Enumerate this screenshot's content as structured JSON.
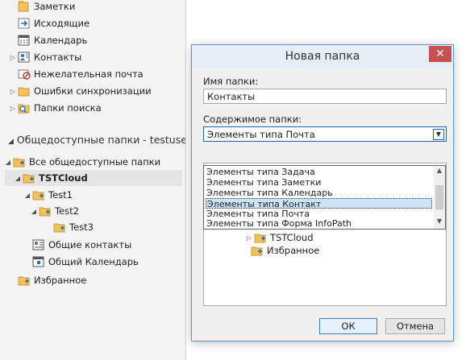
{
  "left_tree": {
    "top_items": [
      {
        "label": "Заметки",
        "icon": "notes-icon",
        "expandable": false
      },
      {
        "label": "Исходящие",
        "icon": "outbox-icon",
        "expandable": false
      },
      {
        "label": "Календарь",
        "icon": "calendar-icon",
        "expandable": false
      },
      {
        "label": "Контакты",
        "icon": "contacts-icon",
        "expandable": true
      },
      {
        "label": "Нежелательная почта",
        "icon": "junk-mail-icon",
        "expandable": false
      },
      {
        "label": "Ошибки синхронизации",
        "icon": "folder-icon",
        "expandable": true
      },
      {
        "label": "Папки поиска",
        "icon": "search-folder-icon",
        "expandable": true
      }
    ],
    "public_group_header": "Общедоступные папки - testuse...",
    "public_items": [
      {
        "label": "Все общедоступные папки",
        "icon": "public-folder-icon"
      },
      {
        "label": "TSTCloud",
        "icon": "public-folder-icon"
      },
      {
        "label": "Test1",
        "icon": "public-folder-icon"
      },
      {
        "label": "Test2",
        "icon": "public-folder-icon"
      },
      {
        "label": "Test3",
        "icon": "public-folder-icon"
      },
      {
        "label": "Общие контакты",
        "icon": "contacts-card-icon"
      },
      {
        "label": "Общий Календарь",
        "icon": "calendar-icon"
      },
      {
        "label": "Избранное",
        "icon": "public-folder-icon"
      }
    ]
  },
  "dialog": {
    "title": "Новая папка",
    "close_glyph": "✕",
    "name_label": "Имя папки:",
    "name_value": "Контакты",
    "contents_label": "Содержимое папки:",
    "contents_value": "Элементы типа Почта",
    "dropdown_options": [
      "Элементы типа Задача",
      "Элементы типа Заметки",
      "Элементы типа Календарь",
      "Элементы типа Контакт",
      "Элементы типа Почта",
      "Элементы типа Форма InfoPath"
    ],
    "dropdown_selected_index": 3,
    "tree_items": [
      "TSTCloud",
      "Избранное"
    ],
    "ok_label": "ОК",
    "cancel_label": "Отмена"
  }
}
